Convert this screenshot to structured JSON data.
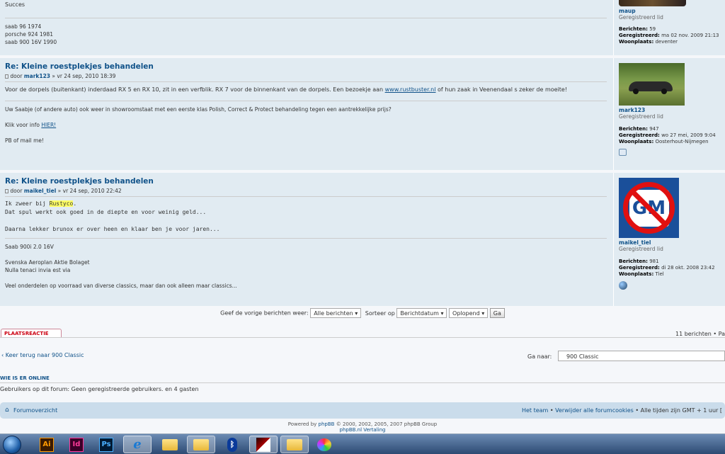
{
  "top_post": {
    "sig_prefix": "Succes",
    "sig_lines": [
      "saab 96 1974",
      "porsche 924 1981",
      "saab 900 16V 1990"
    ],
    "username": "maup",
    "rank": "Geregistreerd lid",
    "posts_label": "Berichten:",
    "posts_val": "59",
    "reg_label": "Geregistreerd:",
    "reg_val": "ma 02 nov. 2009 21:13",
    "loc_label": "Woonplaats:",
    "loc_val": "deventer"
  },
  "post1": {
    "title": "Re: Kleine roestplekjes behandelen",
    "by": "door",
    "author": "mark123",
    "date": "» vr 24 sep, 2010 18:39",
    "text_pre": "Voor de dorpels (buitenkant) inderdaad RX 5 en RX 10, zit in een verfblik. RX 7 voor de binnenkant van de dorpels. Een bezoekje aan",
    "link": "www.rustbuster.nl",
    "text_post": "of hun zaak in Veenendaal s zeker de moeite!",
    "sig1": "Uw Saabje (of andere auto) ook weer in showroomstaat met een eerste klas Polish, Correct & Protect behandeling tegen een aantrekkelijke prijs?",
    "sig2_pre": "Klik voor info",
    "sig2_link": "HIER!",
    "sig3": "PB of mail me!",
    "username": "mark123",
    "rank": "Geregistreerd lid",
    "posts_label": "Berichten:",
    "posts_val": "947",
    "reg_label": "Geregistreerd:",
    "reg_val": "wo 27 mei, 2009 9:04",
    "loc_label": "Woonplaats:",
    "loc_val": "Oosterhout-Nijmegen"
  },
  "post2": {
    "title": "Re: Kleine roestplekjes behandelen",
    "by": "door",
    "author": "maikel_tiel",
    "date": "» vr 24 sep, 2010 22:42",
    "line1_pre": "Ik zweer bij",
    "line1_hl": "Rustyco",
    "line1_post": ".",
    "line2": "Dat spul werkt ook goed in de diepte en voor weinig geld...",
    "line3": "Daarna lekker brunox er over heen en klaar ben je voor jaren...",
    "sig1": "Saab 900i 2.0 16V",
    "sig2": "Svenska Aeroplan Aktie Bolaget",
    "sig3": "Nulla tenaci invia est via",
    "sig4": "Veel onderdelen op voorraad van diverse classics, maar dan ook alleen maar classics...",
    "avatar_text": "GM",
    "username": "maikel_tiel",
    "rank": "Geregistreerd lid",
    "posts_label": "Berichten:",
    "posts_val": "981",
    "reg_label": "Geregistreerd:",
    "reg_val": "di 28 okt. 2008 23:42",
    "loc_label": "Woonplaats:",
    "loc_val": "Tiel"
  },
  "sortbar": {
    "label": "Geef de vorige berichten weer:",
    "filter": "Alle berichten",
    "sort_label": "Sorteer op",
    "sort": "Berichtdatum",
    "order": "Oplopend",
    "go": "Ga"
  },
  "action": {
    "reply": "PLAATSREACTIE",
    "count": "11 berichten • Pa"
  },
  "jump": {
    "back": "Keer terug naar 900 Classic",
    "label": "Ga naar:",
    "value": "900 Classic"
  },
  "online": {
    "heading": "WIE IS ER ONLINE",
    "text": "Gebruikers op dit forum: Geen geregistreerde gebruikers. en 4 gasten"
  },
  "footer": {
    "index": "Forumoverzicht",
    "team": "Het team",
    "sep": "•",
    "cookies": "Verwijder alle forumcookies",
    "times": "• Alle tijden zijn GMT + 1 uur [",
    "powered_pre": "Powered by",
    "phpbb": "phpBB",
    "powered_post": "© 2000, 2002, 2005, 2007 phpBB Group",
    "translation": "phpBB.nl Vertaling"
  },
  "taskbar": {
    "ai": "Ai",
    "id": "Id",
    "ps": "Ps"
  }
}
